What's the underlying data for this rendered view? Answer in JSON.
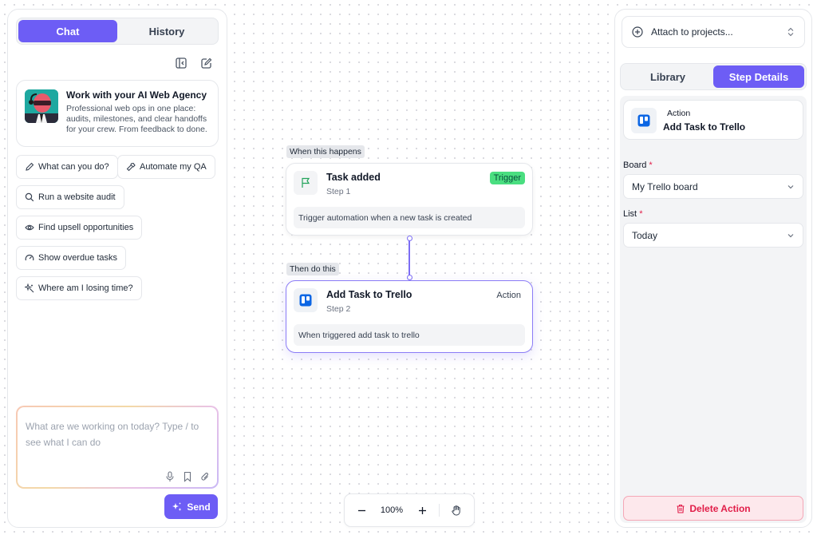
{
  "chat_panel": {
    "tabs": [
      {
        "label": "Chat",
        "active": true
      },
      {
        "label": "History",
        "active": false
      }
    ],
    "agency_card": {
      "title": "Work with your AI Web Agency",
      "description": "Professional web ops in one place: audits, milestones, and clear handoffs for your crew. From feedback to done."
    },
    "suggestions": [
      {
        "label": "What can you do?",
        "icon": "pencil-icon"
      },
      {
        "label": "Automate my QA",
        "icon": "hammer-icon"
      },
      {
        "label": "Run a website audit",
        "icon": "search-icon"
      },
      {
        "label": "Find upsell opportunities",
        "icon": "eye-icon"
      },
      {
        "label": "Show overdue tasks",
        "icon": "gauge-icon"
      },
      {
        "label": "Where am I losing time?",
        "icon": "sparkle-icon"
      }
    ],
    "prompt": {
      "placeholder": "What are we working on today? Type / to see what I can do"
    },
    "send_label": "Send"
  },
  "canvas": {
    "trigger_section_label": "When this happens",
    "action_section_label": "Then do this",
    "trigger_node": {
      "title": "Task added",
      "step": "Step 1",
      "badge": "Trigger",
      "description": "Trigger automation when a new task is created"
    },
    "action_node": {
      "title": "Add Task to Trello",
      "step": "Step 2",
      "badge": "Action",
      "description": "When triggered add task to trello"
    },
    "zoom": {
      "level": "100%"
    }
  },
  "details_panel": {
    "attach_label": "Attach to projects...",
    "tabs": [
      {
        "label": "Library",
        "active": false
      },
      {
        "label": "Step Details",
        "active": true
      }
    ],
    "action_card": {
      "kicker": "Action",
      "name": "Add Task to Trello"
    },
    "board": {
      "label": "Board",
      "required_mark": "*",
      "value": "My Trello board"
    },
    "list": {
      "label": "List",
      "required_mark": "*",
      "value": "Today"
    },
    "delete_label": "Delete Action"
  },
  "colors": {
    "accent": "#6d5df5",
    "trigger_badge": "#4ade80",
    "danger": "#e11d48",
    "trello_blue": "#0c66e4"
  }
}
